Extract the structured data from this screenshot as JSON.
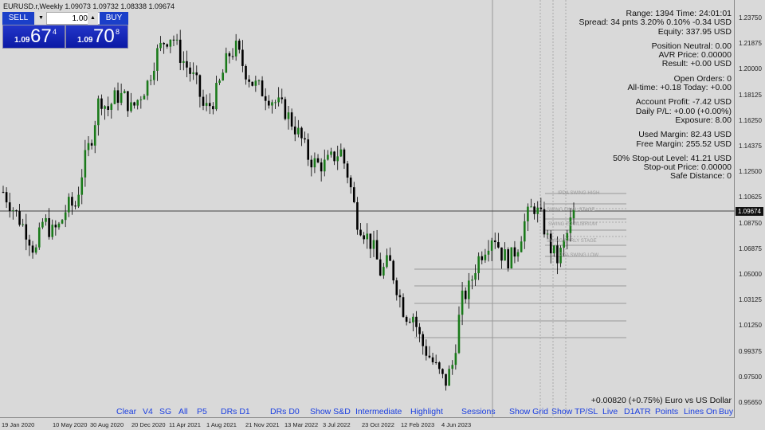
{
  "header": {
    "title": "EURUSD.r,Weekly  1.09073 1.09732 1.08338 1.09674"
  },
  "trade_panel": {
    "sell_label": "SELL",
    "buy_label": "BUY",
    "lot": "1.00",
    "sell_price": {
      "small": "1.09",
      "big": "67",
      "sup": "4"
    },
    "buy_price": {
      "small": "1.09",
      "big": "70",
      "sup": "8"
    },
    "accent": "#1a3fc9"
  },
  "info": {
    "lines": [
      [
        "Range: 1394 Time: 24:01:01",
        "Spread: 34 pnts 3.20% 0.10% -0.34 USD",
        "Equity: 337.95 USD"
      ],
      [
        "Position Neutral: 0.00",
        "AVR Price: 0.00000",
        "Result: +0.00 USD"
      ],
      [
        "Open Orders: 0",
        "All-time: +0.18 Today: +0.00"
      ],
      [
        "Account Profit: -7.42 USD",
        "Daily P/L: +0.00 (+0.00%)",
        "Exposure: 8.00"
      ],
      [
        "Used Margin: 82.43 USD",
        "Free Margin: 255.52 USD"
      ],
      [
        "50% Stop-out Level: 41.21 USD",
        "Stop-out Price: 0.00000",
        "Safe Distance: 0"
      ]
    ]
  },
  "symbol_line": "+0.00820 (+0.75%) Euro vs US Dollar",
  "buttons": [
    "Clear",
    "V4",
    "SG",
    "All",
    "P5",
    "DRs D1",
    "DRs D0",
    "Show S&D",
    "Intermediate",
    "Highlight",
    "Sessions",
    "Show Grid",
    "Show TP/SL",
    "Live",
    "D1ATR",
    "Points",
    "Lines On",
    "Buy"
  ],
  "level_labels": [
    "IPDA SWING HIGH",
    "SWING FINAL STAGE",
    "SWING EQUILIBRIUM",
    "SWING EARLY STAGE",
    "IPDA SWING LOW"
  ],
  "chart_data": {
    "type": "candlestick",
    "current_price": "1.09674",
    "y_ticks": [
      "1.23750",
      "1.21875",
      "1.20000",
      "1.18125",
      "1.16250",
      "1.14375",
      "1.12500",
      "1.10625",
      "1.08750",
      "1.06875",
      "1.05000",
      "1.03125",
      "1.01250",
      "0.99375",
      "0.97500",
      "0.95650"
    ],
    "x_ticks": [
      "19 Jan 2020",
      "10 May 2020",
      "30 Aug 2020",
      "20 Dec 2020",
      "11 Apr 2021",
      "1 Aug 2021",
      "21 Nov 2021",
      "13 Mar 2022",
      "3 Jul 2022",
      "23 Oct 2022",
      "12 Feb 2023",
      "4 Jun 2023"
    ],
    "approx_closes": [
      1.11,
      1.1,
      1.09,
      1.08,
      1.065,
      1.09,
      1.08,
      1.085,
      1.1,
      1.1,
      1.13,
      1.15,
      1.18,
      1.17,
      1.18,
      1.18,
      1.17,
      1.18,
      1.19,
      1.21,
      1.22,
      1.225,
      1.21,
      1.2,
      1.19,
      1.17,
      1.175,
      1.19,
      1.21,
      1.215,
      1.2,
      1.19,
      1.185,
      1.18,
      1.175,
      1.17,
      1.16,
      1.15,
      1.135,
      1.13,
      1.13,
      1.135,
      1.14,
      1.12,
      1.09,
      1.08,
      1.07,
      1.05,
      1.06,
      1.04,
      1.02,
      1.02,
      1.0,
      0.99,
      0.98,
      0.97,
      0.985,
      1.03,
      1.04,
      1.06,
      1.07,
      1.08,
      1.065,
      1.06,
      1.07,
      1.09,
      1.1,
      1.09,
      1.07,
      1.06,
      1.075,
      1.09674
    ],
    "colors": {
      "up": "#1a7a1a",
      "down": "#000000"
    }
  }
}
